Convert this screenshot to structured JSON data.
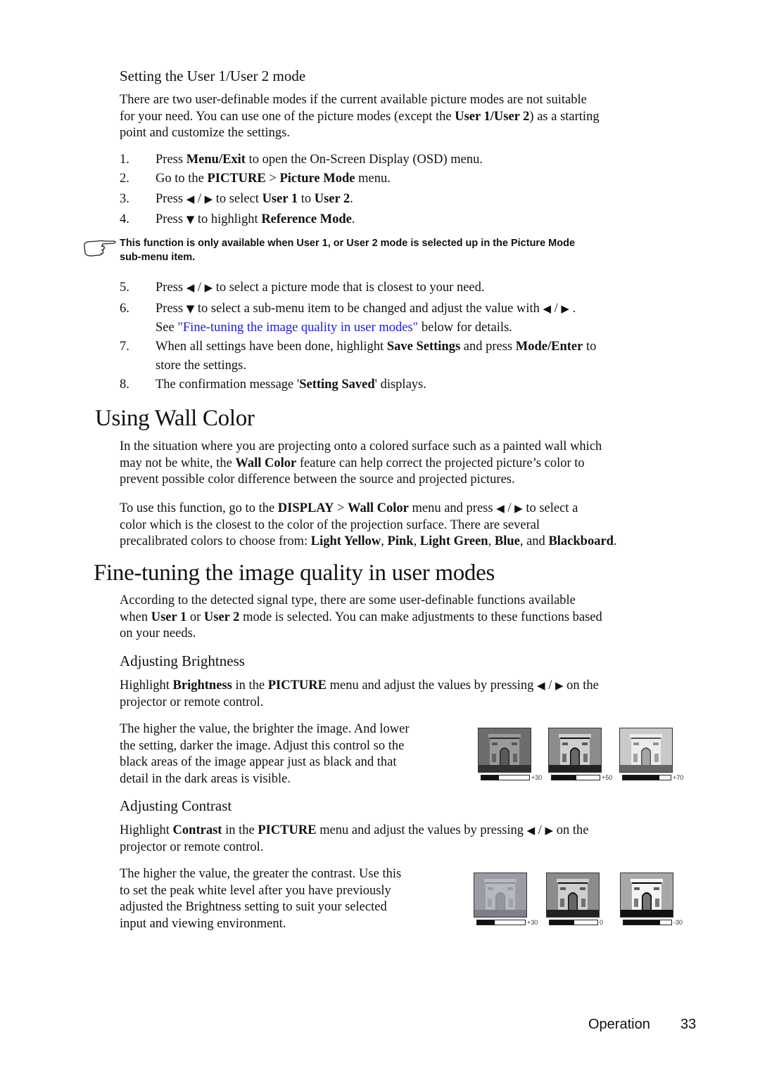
{
  "section_user_mode": {
    "title": "Setting the User 1/User 2 mode",
    "intro": [
      {
        "t": "There are two user-definable modes if the current available picture modes are not suitable"
      },
      {
        "t": "for your need. You can use one of the picture modes (except the "
      },
      {
        "b": "User 1/User 2"
      },
      {
        "t": ") as a starting"
      },
      {
        "t": "point and customize the settings."
      }
    ],
    "intro_lines": [
      "There are two user-definable modes if the current available picture modes are not suitable",
      "for your need. You can use one of the picture modes (except the |User 1/User 2|) as a starting",
      "point and customize the settings."
    ],
    "steps_a": [
      {
        "num": "1.",
        "text": "Press |Menu/Exit| to open the On-Screen Display (OSD) menu."
      },
      {
        "num": "2.",
        "text": "Go to the |PICTURE| > |Picture Mode| menu."
      },
      {
        "num": "3.",
        "text": "Press ◀ / ▶  to select |User 1| to |User 2|."
      },
      {
        "num": "4.",
        "text": "Press ▼  to highlight |Reference Mode|."
      }
    ],
    "note_icon": "pointing-hand-icon",
    "note_lines": [
      "This function is only available when User 1, or User 2 mode is selected up in the Picture Mode",
      "sub-menu item."
    ],
    "steps_b": [
      {
        "num": "5.",
        "lines": [
          "Press ◀ / ▶  to select a picture mode that is closest to your need."
        ]
      },
      {
        "num": "6.",
        "lines": [
          "Press ▼  to select a sub-menu item to be changed and adjust the value with ◀ / ▶ .",
          "See ~\"Fine-tuning the image quality in user modes\"~ below for details."
        ]
      },
      {
        "num": "7.",
        "lines": [
          "When all settings have been done, highlight |Save Settings| and press |Mode/Enter| to",
          "store the settings."
        ]
      },
      {
        "num": "8.",
        "lines": [
          "The confirmation message '|Setting Saved|' displays."
        ]
      }
    ]
  },
  "section_wall_color": {
    "title": "Using Wall Color",
    "para1_lines": [
      "In the situation where you are projecting onto a colored surface such as a painted wall which",
      "may not be white, the |Wall Color| feature can help correct the projected picture’s color to",
      "prevent possible color difference between the source and projected pictures."
    ],
    "para2_lines": [
      "To use this function, go to the |DISPLAY| > |Wall Color| menu and press ◀ / ▶  to select a",
      "color which is the closest to the color of the projection surface. There are several",
      "precalibrated colors to choose from: |Light Yellow|, |Pink|, |Light Green|, |Blue|, and |Blackboard|."
    ]
  },
  "section_fine_tuning": {
    "title": "Fine-tuning the image quality in user modes",
    "intro_lines": [
      "According to the detected signal type, there are some user-definable functions available",
      "when |User 1| or |User 2| mode is selected. You can make adjustments to these functions based",
      "on your needs."
    ],
    "brightness": {
      "title": "Adjusting Brightness",
      "para1_lines": [
        "Highlight |Brightness| in the |PICTURE| menu and adjust the values by pressing ◀ / ▶  on the",
        "projector or remote control."
      ],
      "para2_lines": [
        "The higher the value, the brighter the image. And lower",
        "the setting, darker the image. Adjust this control so the",
        "black areas of the image appear just as black and that",
        "detail in the dark areas is visible."
      ],
      "samples": [
        {
          "label": "+30",
          "level": 0.37,
          "tone": "dark"
        },
        {
          "label": "+50",
          "level": 0.52,
          "tone": "mid"
        },
        {
          "label": "+70",
          "level": 0.76,
          "tone": "light"
        }
      ]
    },
    "contrast": {
      "title": "Adjusting Contrast",
      "para1_lines": [
        "Highlight |Contrast| in the |PICTURE| menu and adjust the values by pressing ◀ / ▶  on the",
        "projector or remote control."
      ],
      "para2_lines": [
        "The higher the value, the greater the contrast. Use this",
        "to set the peak white level after you have previously",
        "adjusted the Brightness setting to suit your selected",
        "input and viewing environment."
      ],
      "samples": [
        {
          "label": "+30",
          "level": 0.37,
          "tone": "flat"
        },
        {
          "label": "0",
          "level": 0.52,
          "tone": "mid"
        },
        {
          "label": "-30",
          "level": 0.76,
          "tone": "high"
        }
      ]
    }
  },
  "footer": {
    "section": "Operation",
    "page": "33"
  },
  "colors": {
    "link": "#1a1aee",
    "text": "#111111"
  }
}
